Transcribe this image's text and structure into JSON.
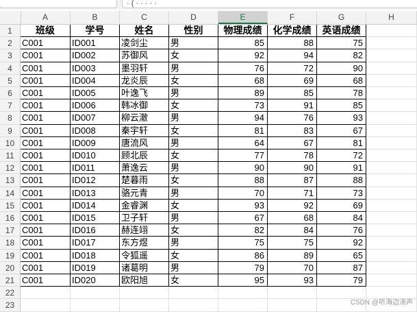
{
  "formula_bar": {
    "fragment": "· ( · · · · ·"
  },
  "columns": [
    "A",
    "B",
    "C",
    "D",
    "E",
    "F",
    "G",
    "H"
  ],
  "selected_column": "E",
  "row_numbers": [
    "1",
    "2",
    "3",
    "4",
    "5",
    "6",
    "7",
    "8",
    "9",
    "10",
    "11",
    "12",
    "13",
    "14",
    "15",
    "16",
    "17",
    "18",
    "19",
    "20",
    "21",
    "22",
    "23"
  ],
  "table": {
    "headers": [
      "班级",
      "学号",
      "姓名",
      "性别",
      "物理成绩",
      "化学成绩",
      "英语成绩"
    ],
    "rows": [
      [
        "C001",
        "ID001",
        "凌剑尘",
        "男",
        "85",
        "88",
        "75"
      ],
      [
        "C001",
        "ID002",
        "苏御风",
        "女",
        "92",
        "94",
        "82"
      ],
      [
        "C001",
        "ID003",
        "墨羽轩",
        "男",
        "76",
        "72",
        "90"
      ],
      [
        "C001",
        "ID004",
        "龙炎辰",
        "女",
        "68",
        "69",
        "68"
      ],
      [
        "C001",
        "ID005",
        "叶逸飞",
        "男",
        "89",
        "85",
        "78"
      ],
      [
        "C001",
        "ID006",
        "韩冰御",
        "女",
        "73",
        "91",
        "85"
      ],
      [
        "C001",
        "ID007",
        "柳云澈",
        "男",
        "94",
        "76",
        "93"
      ],
      [
        "C001",
        "ID008",
        "秦宇轩",
        "女",
        "81",
        "83",
        "67"
      ],
      [
        "C001",
        "ID009",
        "唐流风",
        "男",
        "64",
        "67",
        "81"
      ],
      [
        "C001",
        "ID010",
        "顾北辰",
        "女",
        "77",
        "78",
        "72"
      ],
      [
        "C001",
        "ID011",
        "萧逸云",
        "男",
        "90",
        "90",
        "91"
      ],
      [
        "C001",
        "ID012",
        "楚暮雨",
        "女",
        "88",
        "87",
        "88"
      ],
      [
        "C001",
        "ID013",
        "骆元青",
        "男",
        "70",
        "71",
        "73"
      ],
      [
        "C001",
        "ID014",
        "金睿渊",
        "女",
        "93",
        "92",
        "69"
      ],
      [
        "C001",
        "ID015",
        "卫子轩",
        "男",
        "67",
        "68",
        "84"
      ],
      [
        "C001",
        "ID016",
        "赫连翊",
        "女",
        "82",
        "84",
        "76"
      ],
      [
        "C001",
        "ID017",
        "东方煜",
        "男",
        "75",
        "75",
        "92"
      ],
      [
        "C001",
        "ID018",
        "令狐遥",
        "女",
        "86",
        "89",
        "65"
      ],
      [
        "C001",
        "ID019",
        "诸葛明",
        "男",
        "79",
        "70",
        "87"
      ],
      [
        "C001",
        "ID020",
        "欧阳旭",
        "女",
        "95",
        "93",
        "79"
      ]
    ]
  },
  "watermark": "CSDN @听海边涛声",
  "colors": {
    "accent": "#107c41",
    "header_bg": "#f3f3f3",
    "selected_header_bg": "#d2d2d2"
  }
}
